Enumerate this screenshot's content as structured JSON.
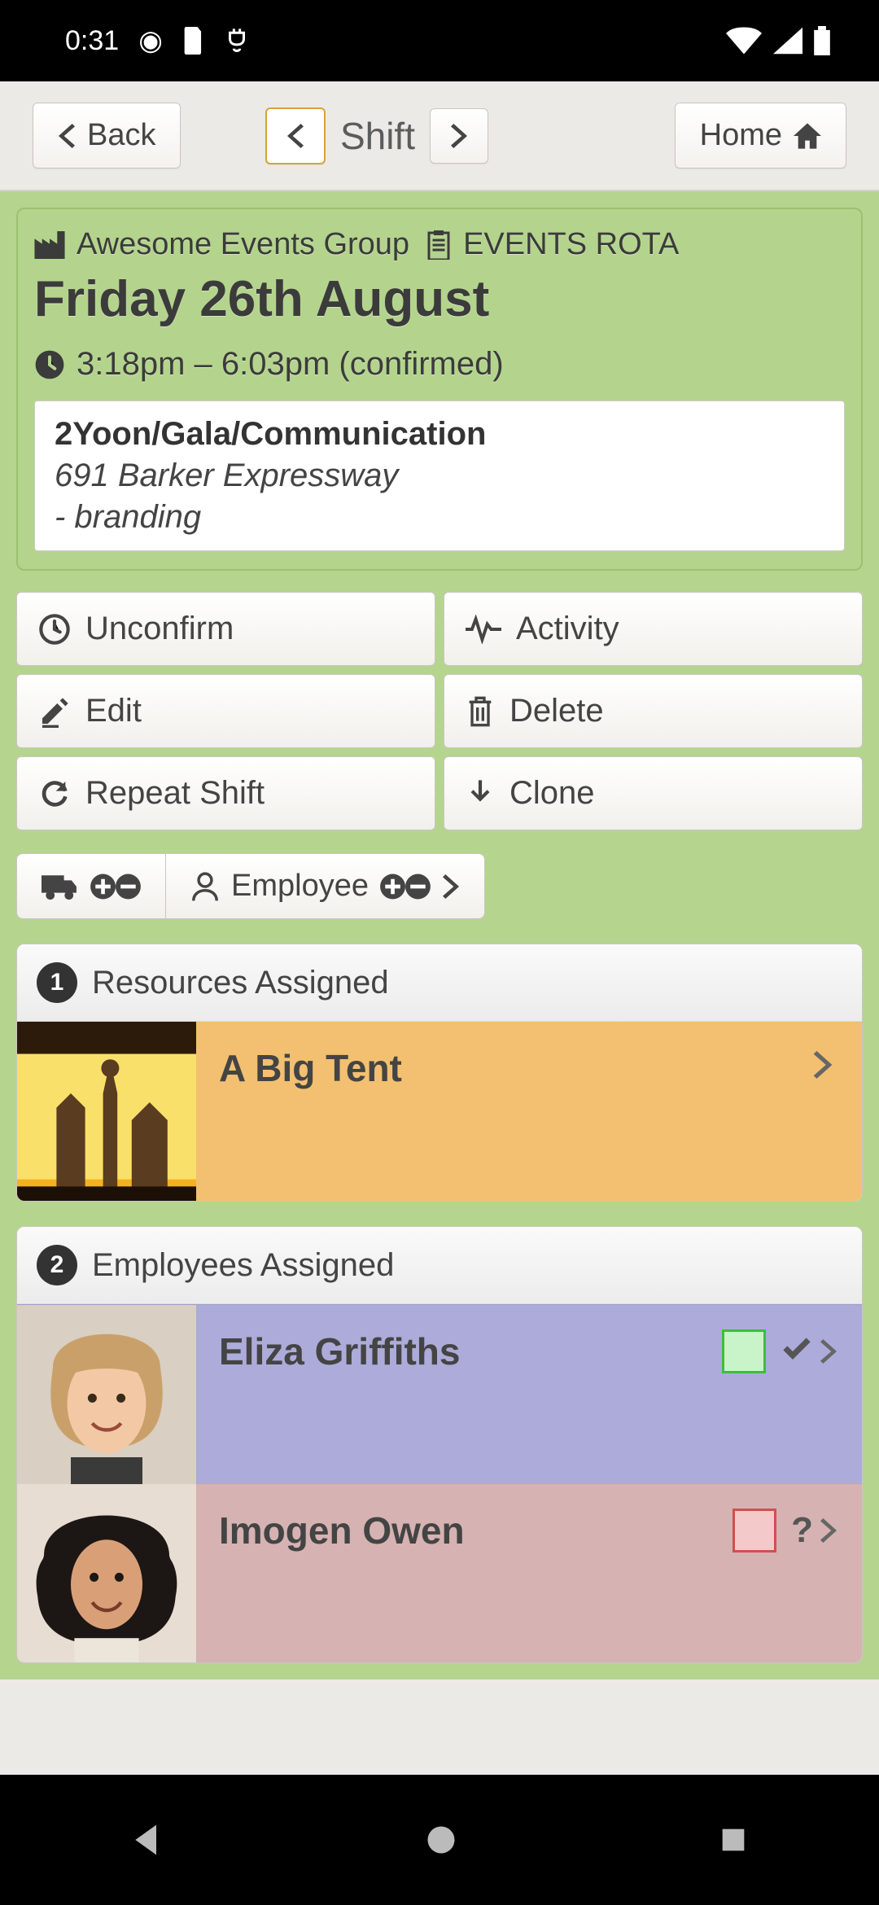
{
  "statusbar": {
    "time": "0:31"
  },
  "topnav": {
    "back_label": "Back",
    "title": "Shift",
    "home_label": "Home"
  },
  "shift": {
    "org_name": "Awesome Events Group",
    "rota_name": "EVENTS ROTA",
    "date_title": "Friday 26th August",
    "time_text": "3:18pm – 6:03pm (confirmed)",
    "detail": {
      "title": "2Yoon/Gala/Communication",
      "address": "691 Barker Expressway",
      "tag": "- branding"
    }
  },
  "actions": {
    "unconfirm": "Unconfirm",
    "activity": "Activity",
    "edit": "Edit",
    "delete": "Delete",
    "repeat": "Repeat Shift",
    "clone": "Clone"
  },
  "addrow": {
    "employee_label": "Employee"
  },
  "resources": {
    "header": "Resources Assigned",
    "count": "1",
    "items": [
      {
        "name": "A Big Tent"
      }
    ]
  },
  "employees": {
    "header": "Employees Assigned",
    "count": "2",
    "items": [
      {
        "name": "Eliza Griffiths",
        "status": "confirmed"
      },
      {
        "name": "Imogen Owen",
        "status": "unknown"
      }
    ]
  }
}
